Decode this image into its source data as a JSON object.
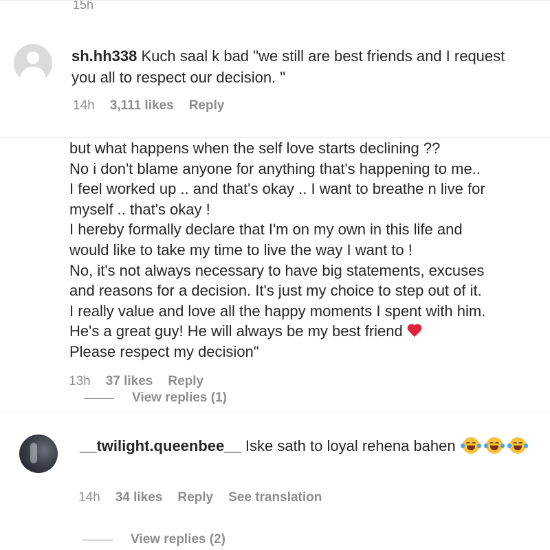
{
  "comment1": {
    "timestamp_above": "15h",
    "username": "sh.hh338",
    "text": "Kuch saal k bad \"we still are best friends and I request you all to respect our decision. \"",
    "time": "14h",
    "likes": "3,111 likes",
    "reply_label": "Reply"
  },
  "comment2": {
    "lines": [
      "but what happens when the self love starts declining ??",
      "No i don't blame anyone for anything that's happening to me..",
      "I feel worked up .. and that's okay .. I want to breathe n live for",
      "myself .. that's okay !",
      "I hereby formally declare that I'm on my own in this life and",
      "would like to take my time to live the way I want to !",
      "No, it's not always necessary to have big statements, excuses",
      "and reasons for a decision. It's just my choice to step out of it.",
      "I really value and love all the happy moments I spent with him.",
      "He's a great guy! He will always be my best friend",
      "Please respect my decision\""
    ],
    "heart_icon": "red-heart-emoji",
    "time": "13h",
    "likes": "37 likes",
    "reply_label": "Reply",
    "view_replies": "View replies (1)"
  },
  "comment3": {
    "username": "__twilight.queenbee__",
    "text": "Iske sath to loyal rehena bahen",
    "emoji_icon": "tears-of-joy-emoji",
    "time": "14h",
    "likes": "34 likes",
    "reply_label": "Reply",
    "see_translation": "See translation",
    "view_replies": "View replies (2)"
  }
}
